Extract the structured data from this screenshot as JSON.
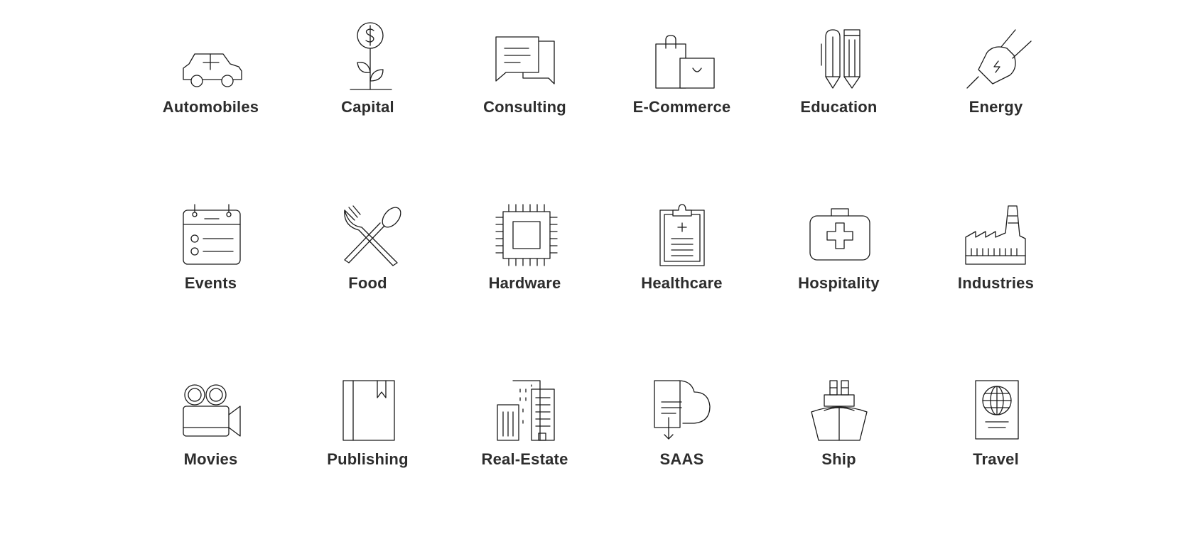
{
  "industries": [
    {
      "label": "Automobiles",
      "icon": "car-icon"
    },
    {
      "label": "Capital",
      "icon": "money-plant-icon"
    },
    {
      "label": "Consulting",
      "icon": "chat-bubbles-icon"
    },
    {
      "label": "E-Commerce",
      "icon": "shopping-bags-icon"
    },
    {
      "label": "Education",
      "icon": "pencils-icon"
    },
    {
      "label": "Energy",
      "icon": "plug-icon"
    },
    {
      "label": "Events",
      "icon": "calendar-icon"
    },
    {
      "label": "Food",
      "icon": "fork-spoon-icon"
    },
    {
      "label": "Hardware",
      "icon": "chip-icon"
    },
    {
      "label": "Healthcare",
      "icon": "clipboard-icon"
    },
    {
      "label": "Hospitality",
      "icon": "first-aid-kit-icon"
    },
    {
      "label": "Industries",
      "icon": "factory-icon"
    },
    {
      "label": "Movies",
      "icon": "movie-camera-icon"
    },
    {
      "label": "Publishing",
      "icon": "book-icon"
    },
    {
      "label": "Real-Estate",
      "icon": "buildings-icon"
    },
    {
      "label": "SAAS",
      "icon": "cloud-document-icon"
    },
    {
      "label": "Ship",
      "icon": "ship-icon"
    },
    {
      "label": "Travel",
      "icon": "passport-icon"
    }
  ]
}
